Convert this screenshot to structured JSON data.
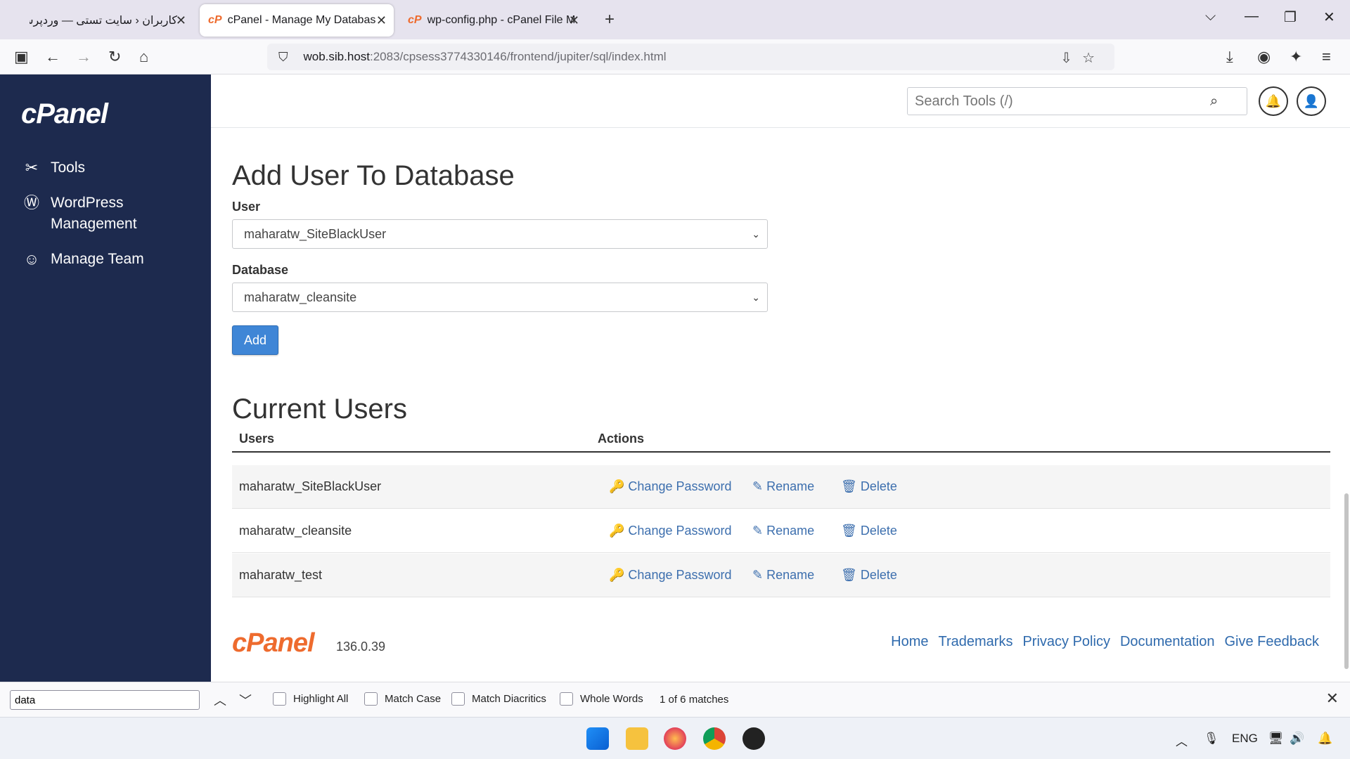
{
  "browser": {
    "tabs": [
      {
        "label": "کاربران ‹ سایت تستی — وردپرس",
        "active": false
      },
      {
        "label": "cPanel - Manage My Databases",
        "active": true
      },
      {
        "label": "wp-config.php - cPanel File Mar",
        "active": false
      }
    ],
    "url_host": "wob.sib.host",
    "url_rest": ":2083/cpsess3774330146/frontend/jupiter/sql/index.html"
  },
  "sidebar": {
    "logo": "cPanel",
    "items": [
      {
        "label": "Tools",
        "icon": "tools-icon"
      },
      {
        "label": "WordPress Management",
        "icon": "wordpress-icon"
      },
      {
        "label": "Manage Team",
        "icon": "team-icon"
      }
    ]
  },
  "header": {
    "search_placeholder": "Search Tools (/)"
  },
  "add_user": {
    "title": "Add User To Database",
    "user_label": "User",
    "user_value": "maharatw_SiteBlackUser",
    "database_label": "Database",
    "database_value": "maharatw_cleansite",
    "add_button": "Add"
  },
  "current_users": {
    "title": "Current Users",
    "col_users": "Users",
    "col_actions": "Actions",
    "action_labels": {
      "change_password": "Change Password",
      "rename": "Rename",
      "delete": "Delete"
    },
    "rows": [
      "maharatw_SiteBlackUser",
      "maharatw_cleansite",
      "maharatw_test"
    ]
  },
  "footer": {
    "logo": "cPanel",
    "version": "136.0.39",
    "links": [
      "Home",
      "Trademarks",
      "Privacy Policy",
      "Documentation",
      "Give Feedback"
    ]
  },
  "findbar": {
    "query": "data",
    "options": [
      "Highlight All",
      "Match Case",
      "Match Diacritics",
      "Whole Words"
    ],
    "status": "1 of 6 matches"
  },
  "taskbar": {
    "language": "ENG"
  },
  "colors": {
    "sidebar_bg": "#1d2a4e",
    "accent_orange": "#ee6b2e",
    "link_blue": "#3d6fae",
    "button_blue": "#3f86d6"
  }
}
